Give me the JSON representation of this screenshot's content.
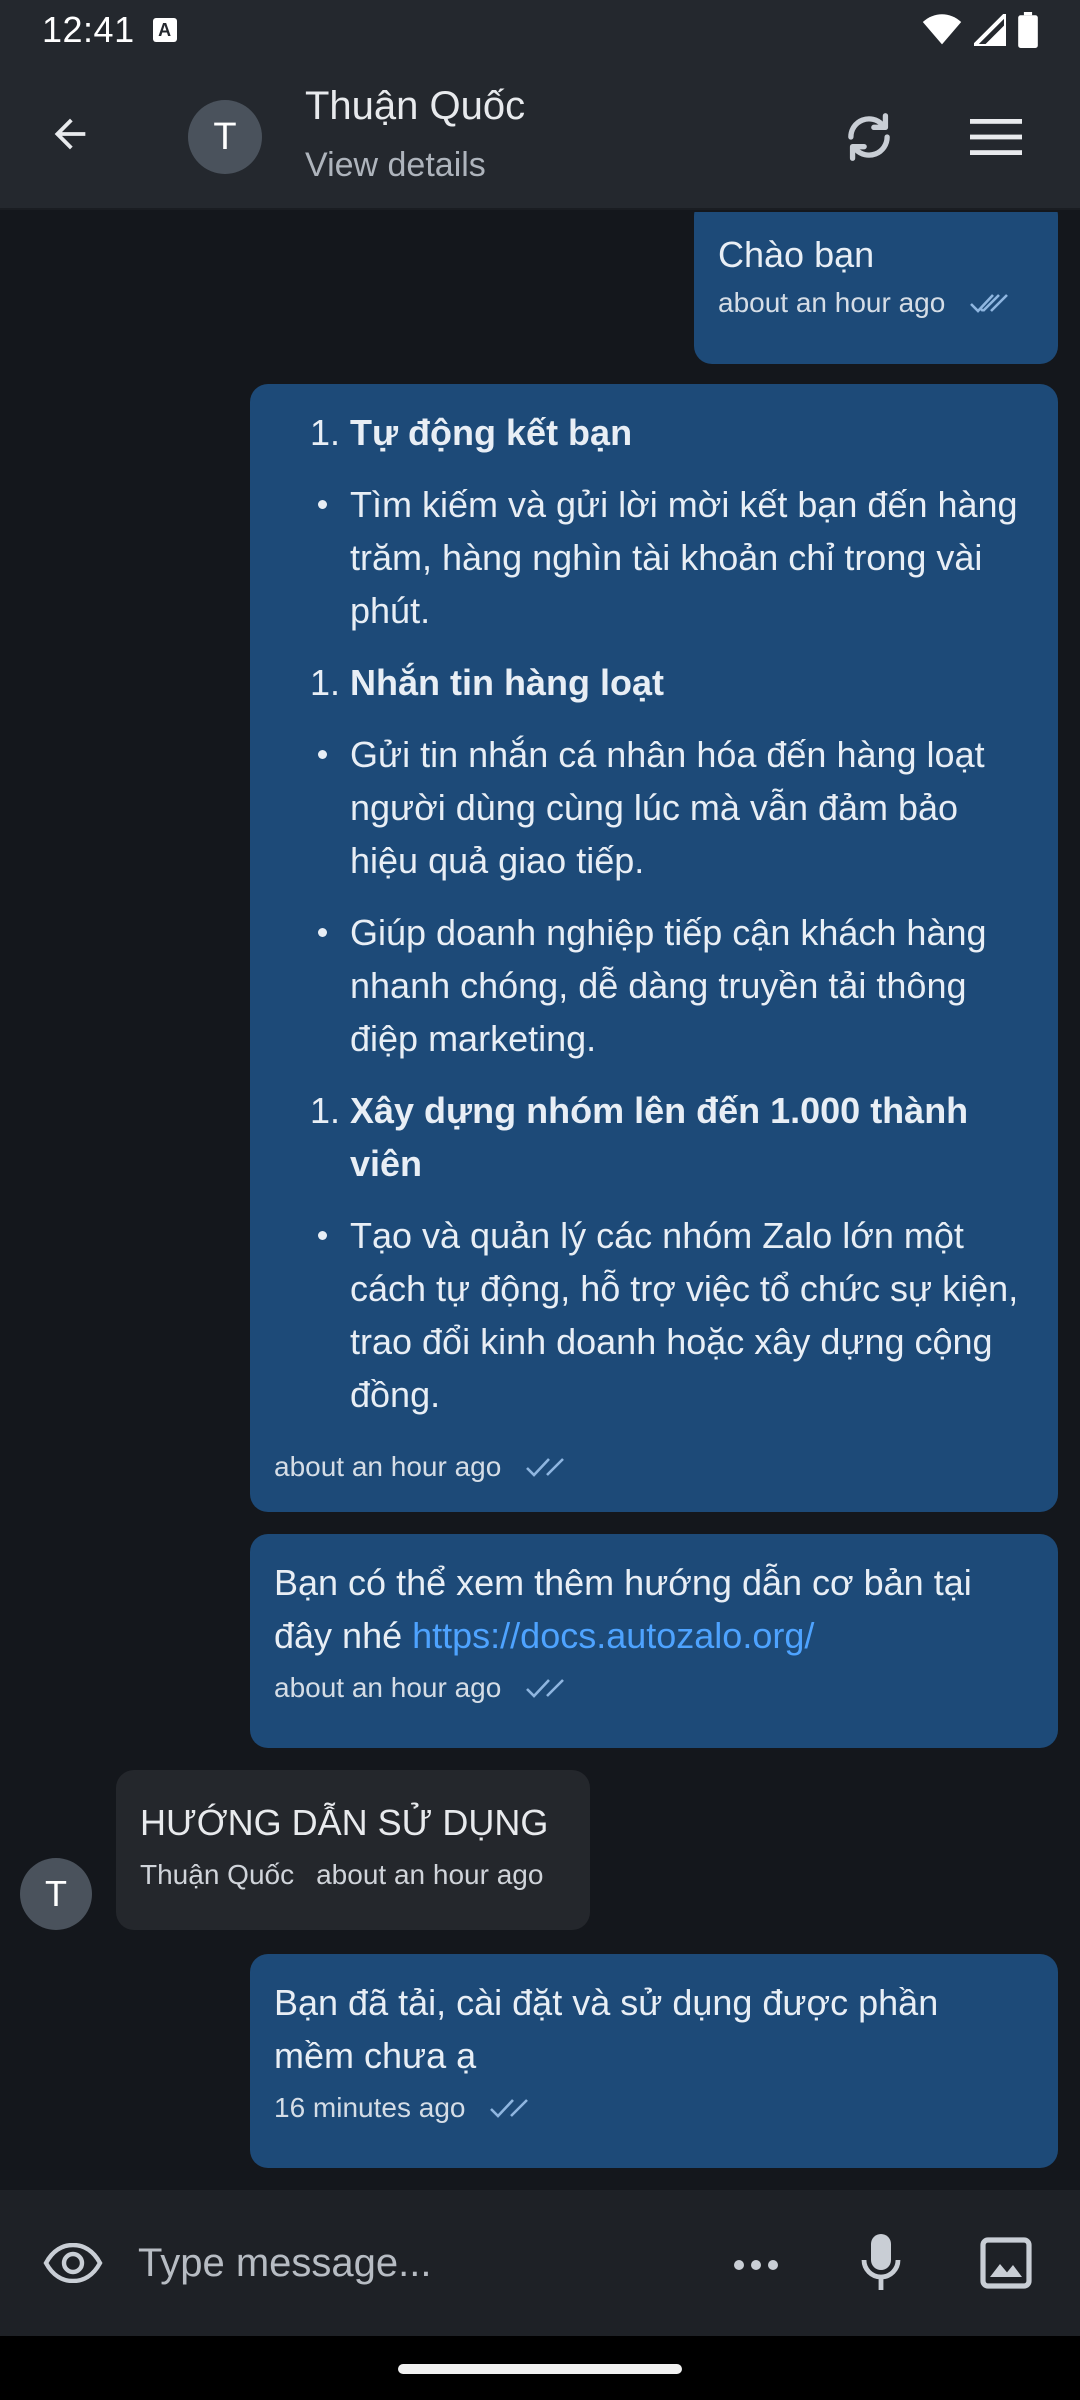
{
  "status_bar": {
    "time": "12:41",
    "badge": "A"
  },
  "header": {
    "avatar_initial": "T",
    "contact_name": "Thuận Quốc",
    "subtitle": "View details"
  },
  "messages": {
    "m1": {
      "text": "Chào bạn",
      "time": "about an hour ago"
    },
    "m2": {
      "items": [
        {
          "n": "1.",
          "text": "Tự động kết bạn"
        },
        {
          "text": "Tìm kiếm và gửi lời mời kết bạn đến hàng trăm, hàng nghìn tài khoản chỉ trong vài phút."
        },
        {
          "n": "1.",
          "text": "Nhắn tin hàng loạt"
        },
        {
          "text": "Gửi tin nhắn cá nhân hóa đến hàng loạt người dùng cùng lúc mà vẫn đảm bảo hiệu quả giao tiếp."
        },
        {
          "text": "Giúp doanh nghiệp tiếp cận khách hàng nhanh chóng, dễ dàng truyền tải thông điệp marketing."
        },
        {
          "n": "1.",
          "text": "Xây dựng nhóm lên đến 1.000 thành viên"
        },
        {
          "text": "Tạo và quản lý các nhóm Zalo lớn một cách tự động, hỗ trợ việc tổ chức sự kiện, trao đổi kinh doanh hoặc xây dựng cộng đồng."
        }
      ],
      "time": "about an hour ago"
    },
    "m3": {
      "text": "Bạn có thể xem thêm hướng dẫn cơ bản tại đây nhé",
      "link": "https://docs.autozalo.org/",
      "time": "about an hour ago"
    },
    "m4": {
      "text": "HƯỚNG DẪN SỬ DỤNG",
      "sender": "Thuận Quốc",
      "time": "about an hour ago",
      "avatar_initial": "T"
    },
    "m5": {
      "text": "Bạn đã tải, cài đặt và sử dụng được phần mềm chưa ạ",
      "time": "16 minutes ago"
    }
  },
  "composer": {
    "placeholder": "Type message..."
  },
  "colors": {
    "bar": "#24282e",
    "background": "#14171c",
    "outgoing_bubble": "#1d4a78",
    "incoming_bubble": "#24272c",
    "link": "#4ea3ff"
  },
  "icons": [
    "arrow-back-icon",
    "sync-icon",
    "menu-icon",
    "double-check-icon",
    "eye-icon",
    "more-horiz-icon",
    "mic-icon",
    "image-icon",
    "wifi-icon",
    "signal-icon",
    "battery-icon"
  ]
}
